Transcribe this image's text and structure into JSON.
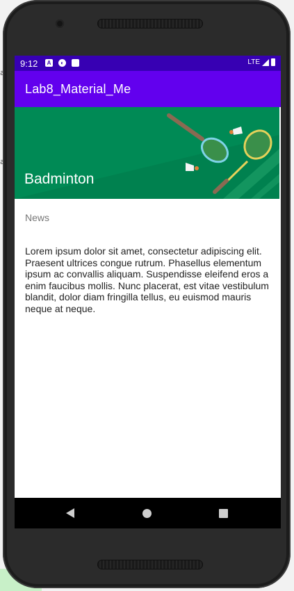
{
  "status_bar": {
    "time": "9:12",
    "notification_icons": [
      "a-icon",
      "sync-icon",
      "sd-card-icon"
    ],
    "network": "LTE"
  },
  "app_bar": {
    "title": "Lab8_Material_Me",
    "color": "#6200ee"
  },
  "card": {
    "title": "Badminton",
    "subtitle": "News",
    "body": "Lorem ipsum dolor sit amet, consectetur adipiscing elit. Praesent ultrices congue rutrum. Phasellus elementum ipsum ac convallis aliquam. Suspendisse eleifend eros a enim faucibus mollis. Nunc placerat, est vitae vestibulum blandit, dolor diam fringilla tellus, eu euismod mauris neque at neque.",
    "image_color": "#00814f"
  },
  "nav_bar": {
    "buttons": [
      "back-icon",
      "home-icon",
      "recents-icon"
    ]
  },
  "colors": {
    "status_bar": "#3700b3",
    "accent": "#6200ee"
  }
}
